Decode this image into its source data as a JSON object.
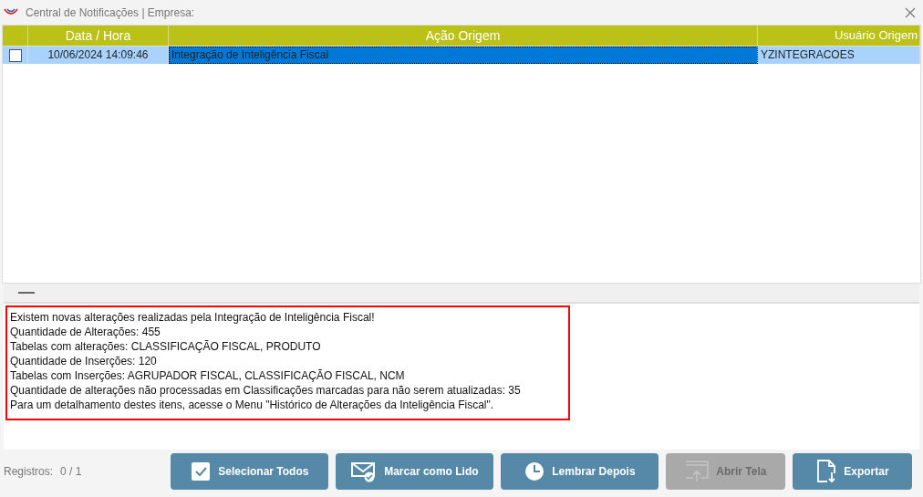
{
  "window": {
    "title": "Central de Notificações | Empresa:"
  },
  "table": {
    "columns": [
      "Data / Hora",
      "Ação Origem",
      "Usuário Origem"
    ],
    "rows": [
      {
        "checked": false,
        "selected": true,
        "cells": [
          {
            "text": "10/06/2024 14:09:46",
            "focused": false
          },
          {
            "text": "Integração de Inteligência Fiscal",
            "focused": true
          },
          {
            "text": "YZINTEGRACOES",
            "focused": false
          }
        ]
      }
    ]
  },
  "message": {
    "highlighted": true,
    "lines": [
      "Existem novas alterações realizadas pela Integração de Inteligência Fiscal!",
      "Quantidade de Alterações: 455",
      "Tabelas com alterações: CLASSIFICAÇÃO FISCAL, PRODUTO",
      "Quantidade de Inserções: 120",
      "Tabelas com Inserções: AGRUPADOR FISCAL, CLASSIFICAÇÃO FISCAL, NCM",
      "Quantidade de alterações não processadas em Classificações marcadas para não serem atualizadas: 35",
      "Para um detalhamento destes itens, acesse o Menu \"Histórico de Alterações da Inteligência Fiscal\"."
    ]
  },
  "footer": {
    "records_label": "Registros:",
    "records_value": "0 / 1",
    "buttons": [
      {
        "label": "Selecionar Todos",
        "kind": "check",
        "disabled": false
      },
      {
        "label": "Marcar como Lido",
        "kind": "mail",
        "disabled": false
      },
      {
        "label": "Lembrar Depois",
        "kind": "clock",
        "disabled": false
      },
      {
        "label": "Abrir Tela",
        "kind": "window",
        "disabled": true
      },
      {
        "label": "Exportar",
        "kind": "export",
        "disabled": false
      }
    ]
  }
}
